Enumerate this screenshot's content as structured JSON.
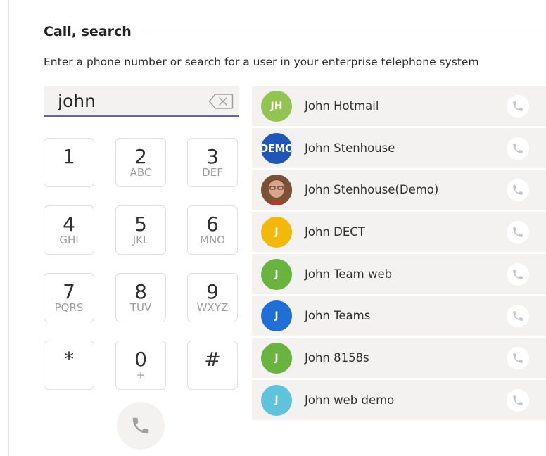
{
  "header": {
    "title": "Call, search"
  },
  "subtitle": "Enter a phone number or search for a user in your enterprise telephone system",
  "search": {
    "value": "john"
  },
  "dialpad": {
    "keys": [
      {
        "digit": "1",
        "letters": ""
      },
      {
        "digit": "2",
        "letters": "ABC"
      },
      {
        "digit": "3",
        "letters": "DEF"
      },
      {
        "digit": "4",
        "letters": "GHI"
      },
      {
        "digit": "5",
        "letters": "JKL"
      },
      {
        "digit": "6",
        "letters": "MNO"
      },
      {
        "digit": "7",
        "letters": "PQRS"
      },
      {
        "digit": "8",
        "letters": "TUV"
      },
      {
        "digit": "9",
        "letters": "WXYZ"
      },
      {
        "digit": "*",
        "letters": ""
      },
      {
        "digit": "0",
        "letters": "+"
      },
      {
        "digit": "#",
        "letters": ""
      }
    ]
  },
  "results": [
    {
      "name": "John Hotmail",
      "initials": "JH",
      "color": "#92c353"
    },
    {
      "name": "John Stenhouse",
      "initials": "DEMO",
      "color": "#1f56b8"
    },
    {
      "name": "John Stenhouse(Demo)",
      "initials": "",
      "color": "#8a5a3c"
    },
    {
      "name": "John DECT",
      "initials": "J",
      "color": "#f2b90c"
    },
    {
      "name": "John Team web",
      "initials": "J",
      "color": "#6bb33f"
    },
    {
      "name": "John Teams",
      "initials": "J",
      "color": "#1f6fd6"
    },
    {
      "name": "John 8158s",
      "initials": "J",
      "color": "#6bb33f"
    },
    {
      "name": "John web demo",
      "initials": "J",
      "color": "#5ec3db"
    }
  ],
  "icons": {
    "backspace": "backspace-icon",
    "call": "phone-icon"
  },
  "colors": {
    "accent": "#6264a7",
    "row_bg": "#f3f2f1",
    "icon_gray": "#c8c6c4"
  }
}
